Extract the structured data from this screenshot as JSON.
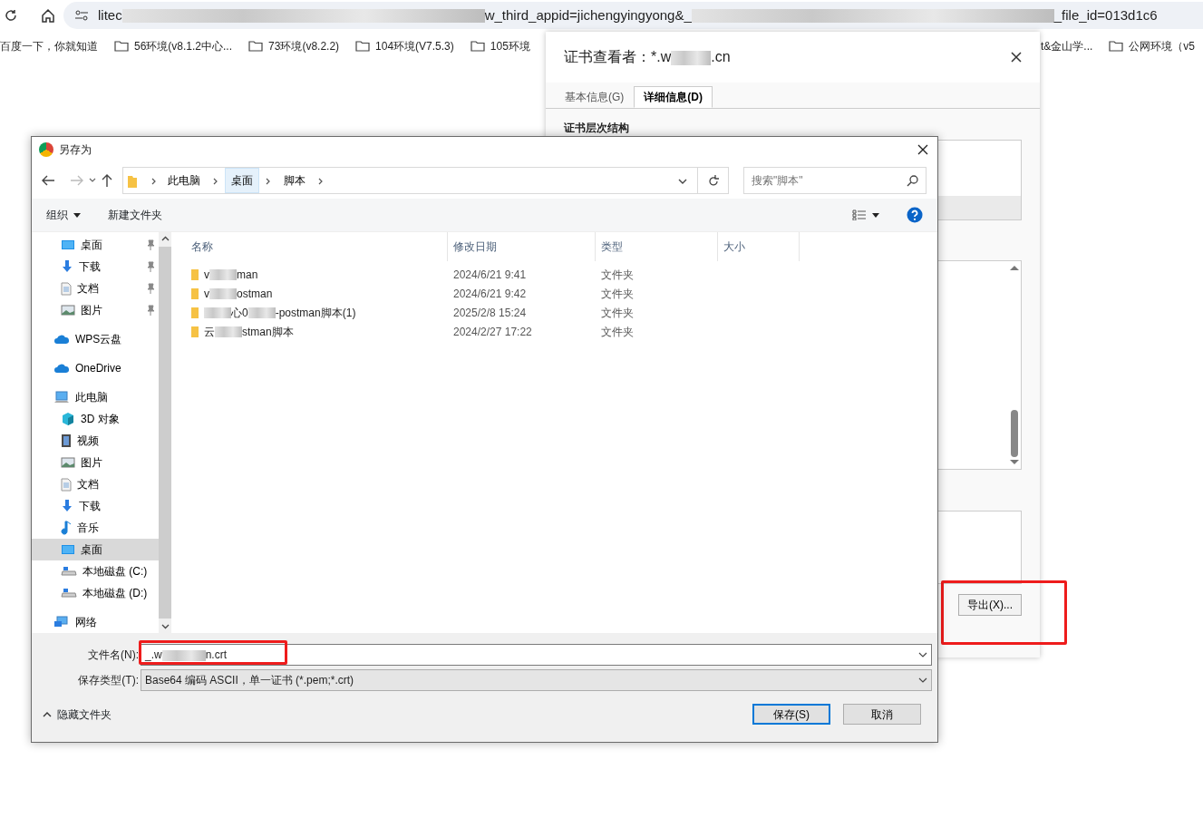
{
  "browser": {
    "url": [
      {
        "kind": "text",
        "text": "litec"
      },
      {
        "kind": "blur"
      },
      {
        "kind": "text",
        "text": "w_third_appid=jichengyingyong&_"
      },
      {
        "kind": "blur"
      },
      {
        "kind": "text",
        "text": "_file_id=013d1c6"
      }
    ],
    "bookmarks_left": [
      {
        "label": "百度一下，你就知道",
        "kind": "page"
      },
      {
        "label": "56环境(v8.1.2中心...",
        "kind": "folder"
      },
      {
        "label": "73环境(v8.2.2)",
        "kind": "folder"
      },
      {
        "label": "104环境(V7.5.3)",
        "kind": "folder"
      },
      {
        "label": "105环境",
        "kind": "folder"
      }
    ],
    "bookmarks_right": [
      {
        "label": "t&金山学...",
        "kind": "page"
      },
      {
        "label": "公网环境（v5",
        "kind": "folder"
      }
    ]
  },
  "cert_viewer": {
    "title": [
      {
        "kind": "text",
        "text": "证书查看者：*.w"
      },
      {
        "kind": "blur"
      },
      {
        "kind": "text",
        "text": ".cn"
      }
    ],
    "tabs": [
      {
        "label": "基本信息(G)",
        "selected": false
      },
      {
        "label": "详细信息(D)",
        "selected": true
      }
    ],
    "section_label": "证书层次结构",
    "export_button": "导出(X)..."
  },
  "save_dialog": {
    "title": "另存为",
    "breadcrumb": [
      {
        "label": "此电脑",
        "selected": false
      },
      {
        "label": "桌面",
        "selected": true
      },
      {
        "label": "脚本",
        "selected": false
      }
    ],
    "search_placeholder": "搜索\"脚本\"",
    "toolbar": {
      "organize": "组织",
      "new_folder": "新建文件夹"
    },
    "sidebar": {
      "items": [
        {
          "label": "桌面",
          "kind": "desktop",
          "pinned": true,
          "selected": false
        },
        {
          "label": "下载",
          "kind": "download",
          "pinned": true,
          "selected": false
        },
        {
          "label": "文档",
          "kind": "document",
          "pinned": true,
          "selected": false
        },
        {
          "label": "图片",
          "kind": "picture",
          "pinned": true,
          "selected": false
        },
        {
          "label": "WPS云盘",
          "kind": "cloud",
          "pinned": false,
          "selected": false
        },
        {
          "label": "OneDrive",
          "kind": "cloud",
          "pinned": false,
          "selected": false
        },
        {
          "label": "此电脑",
          "kind": "computer",
          "pinned": false,
          "selected": false,
          "children": [
            {
              "label": "3D 对象",
              "kind": "cube",
              "pinned": false,
              "selected": false
            },
            {
              "label": "视频",
              "kind": "video",
              "pinned": false,
              "selected": false
            },
            {
              "label": "图片",
              "kind": "picture",
              "pinned": false,
              "selected": false
            },
            {
              "label": "文档",
              "kind": "document",
              "pinned": false,
              "selected": false
            },
            {
              "label": "下载",
              "kind": "download",
              "pinned": false,
              "selected": false
            },
            {
              "label": "音乐",
              "kind": "music",
              "pinned": false,
              "selected": false
            },
            {
              "label": "桌面",
              "kind": "desktop",
              "pinned": false,
              "selected": true
            },
            {
              "label": "本地磁盘 (C:)",
              "kind": "drive",
              "pinned": false,
              "selected": false
            },
            {
              "label": "本地磁盘 (D:)",
              "kind": "drive",
              "pinned": false,
              "selected": false
            }
          ]
        },
        {
          "label": "网络",
          "kind": "network",
          "pinned": false,
          "selected": false
        }
      ]
    },
    "columns": [
      "名称",
      "修改日期",
      "类型",
      "大小"
    ],
    "rows": [
      {
        "name": [
          {
            "kind": "text",
            "text": "v"
          },
          {
            "kind": "blur"
          },
          {
            "kind": "text",
            "text": "man"
          }
        ],
        "modified": "2024/6/21 9:41",
        "type": "文件夹"
      },
      {
        "name": [
          {
            "kind": "text",
            "text": "v"
          },
          {
            "kind": "blur"
          },
          {
            "kind": "text",
            "text": "ostman"
          }
        ],
        "modified": "2024/6/21 9:42",
        "type": "文件夹"
      },
      {
        "name": [
          {
            "kind": "blur"
          },
          {
            "kind": "text",
            "text": "心0"
          },
          {
            "kind": "blur"
          },
          {
            "kind": "text",
            "text": "-postman脚本(1)"
          }
        ],
        "modified": "2025/2/8 15:24",
        "type": "文件夹"
      },
      {
        "name": [
          {
            "kind": "text",
            "text": "云"
          },
          {
            "kind": "blur"
          },
          {
            "kind": "text",
            "text": "stman脚本"
          }
        ],
        "modified": "2024/2/27 17:22",
        "type": "文件夹"
      }
    ],
    "file_name": {
      "label": "文件名(N):",
      "value": [
        {
          "kind": "text",
          "text": "_.w"
        },
        {
          "kind": "blur"
        },
        {
          "kind": "text",
          "text": "n.crt"
        }
      ]
    },
    "file_type": {
      "label": "保存类型(T):",
      "value": "Base64 编码 ASCII，单一证书 (*.pem;*.crt)"
    },
    "hide_folders": "隐藏文件夹",
    "buttons": [
      {
        "label": "保存(S)",
        "kind": "primary"
      },
      {
        "label": "取消",
        "kind": "secondary"
      }
    ]
  }
}
